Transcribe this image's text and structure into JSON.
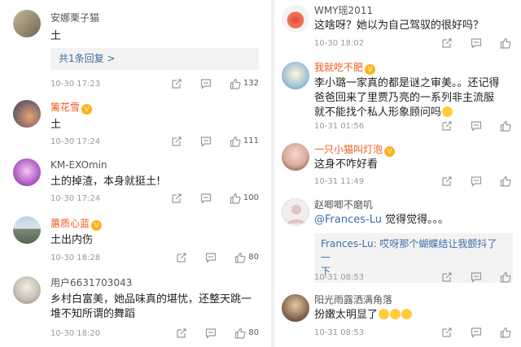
{
  "left_comments": [
    {
      "username": "安娜栗子猫",
      "vip": false,
      "content": "土",
      "reply_link": "共1条回复 >",
      "time": "10-30 17:23",
      "likes": "132",
      "avatar": "cat-photo-avatar"
    },
    {
      "username": "篱花雪",
      "vip": true,
      "content": "土",
      "time": "10-30 17:24",
      "likes": "111",
      "avatar": "sunset-avatar"
    },
    {
      "username": "KM-EXOmin",
      "vip": false,
      "content": "土的掉渣，本身就挺土!",
      "time": "10-30 17:24",
      "likes": "100",
      "avatar": "purple-cartoon-avatar"
    },
    {
      "username": "蕙质心蓝",
      "vip": true,
      "content": "土出内伤",
      "time": "10-30 18:28",
      "likes": "80",
      "avatar": "landscape-avatar"
    },
    {
      "username": "用户6631703043",
      "vip": false,
      "content_lines": [
        "乡村白富美，她品味真的堪忧，还整天跳一",
        "堆不知所谓的舞蹈"
      ],
      "time": "10-30 18:20",
      "likes": "80",
      "avatar": "person-avatar"
    }
  ],
  "right_comments": [
    {
      "username": "WMY瑶2011",
      "vip": false,
      "content": "这啥呀？她以为自己驾驭的很好吗？",
      "time": "10-30 18:02",
      "avatar": "red-fox-avatar"
    },
    {
      "username": "我就吃不肥",
      "vip": true,
      "content_lines": [
        "李小璐一家真的都是谜之审美。。还记得",
        "爸爸回来了里贾乃亮的一系列非主流服",
        "就不能找个私人形象顾问吗"
      ],
      "time": "10-31 01:56",
      "avatar": "cartoon-face-avatar"
    },
    {
      "username": "一只小猫叫灯泡",
      "vip": true,
      "content": "这身不咋好看",
      "time": "10-31 11:49",
      "avatar": "girl-avatar"
    },
    {
      "username": "赵唧唧不磨叽",
      "vip": false,
      "mention": "@Frances-Lu",
      "content_after": " 觉得觉得。。。",
      "reply_lines": [
        "Frances-Lu: 哎呀那个蝴蝶结让我颤抖了一",
        "下"
      ],
      "time": "10-31 08:53",
      "avatar": "default-avatar"
    },
    {
      "username": "阳光雨露洒满角落",
      "vip": false,
      "content": "扮嫩太明显了",
      "time": "10-31 08:53",
      "avatar": "man-avatar"
    }
  ],
  "colors": {
    "vip_name": "#f25a17",
    "link": "#3c6ea8",
    "time": "#999999"
  },
  "icons": {
    "share": "share-icon",
    "comment": "comment-icon",
    "like": "thumb-up-icon",
    "vip": "vip-badge-icon"
  }
}
